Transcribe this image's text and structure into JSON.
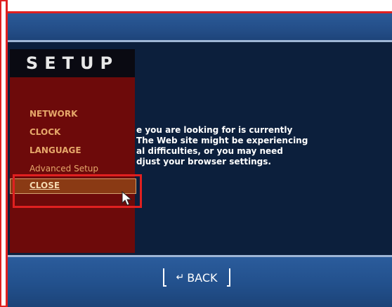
{
  "setup": {
    "title": "SETUP",
    "menu": [
      {
        "id": "network",
        "label": "NETWORK"
      },
      {
        "id": "clock",
        "label": "CLOCK"
      },
      {
        "id": "language",
        "label": "LANGUAGE"
      },
      {
        "id": "advanced",
        "label": "Advanced Setup"
      },
      {
        "id": "close",
        "label": "CLOSE"
      }
    ],
    "selected": "CLOSE"
  },
  "message": {
    "lines": [
      "e you are looking for is currently",
      " The Web site might be experiencing",
      "al difficulties, or you may need",
      "djust your browser settings."
    ]
  },
  "footer": {
    "back_label": "BACK",
    "back_icon": "return-arrow-icon"
  },
  "colors": {
    "header_blue": "#244e88",
    "main_navy": "#0c1f3c",
    "panel_red": "#6d0a0a",
    "menu_text": "#e6a86a",
    "annotation_red": "#e02020"
  }
}
